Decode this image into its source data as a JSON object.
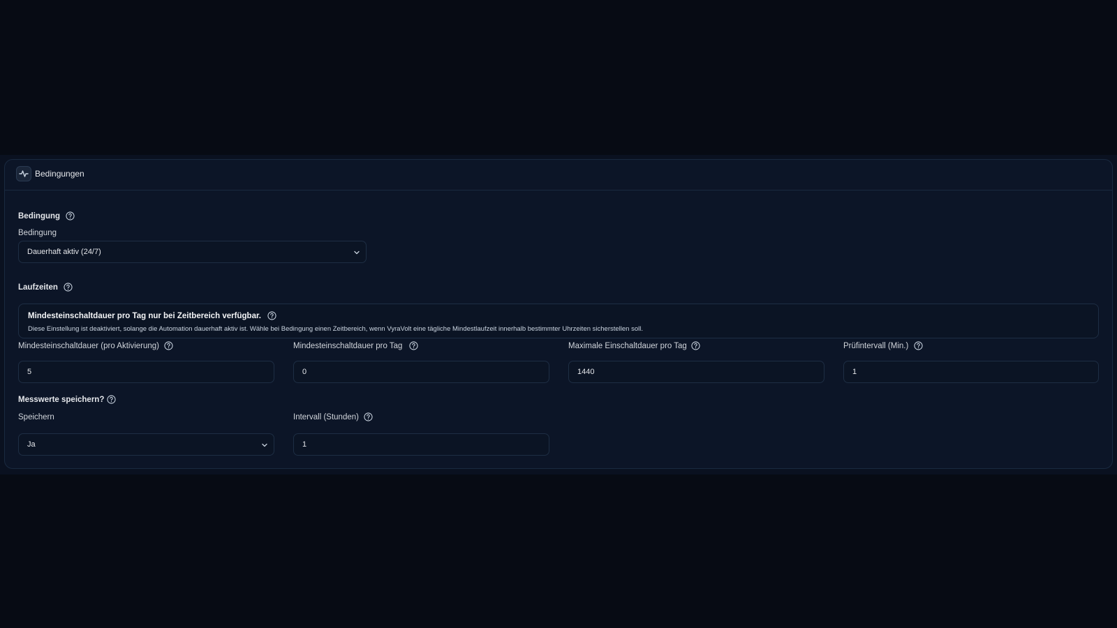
{
  "card": {
    "title": "Bedingungen",
    "icon": "activity-icon"
  },
  "bedingung": {
    "section_label": "Bedingung",
    "field_label": "Bedingung",
    "selected": "Dauerhaft aktiv (24/7)"
  },
  "laufzeiten": {
    "section_label": "Laufzeiten",
    "notice_title": "Mindesteinschaltdauer pro Tag nur bei Zeitbereich verfügbar.",
    "notice_text": "Diese Einstellung ist deaktiviert, solange die Automation dauerhaft aktiv ist. Wähle bei Bedingung einen Zeitbereich, wenn VyraVolt eine tägliche Mindestlaufzeit innerhalb bestimmter Uhrzeiten sicherstellen soll.",
    "fields": [
      {
        "label": "Mindesteinschaltdauer (pro Aktivierung)",
        "value": "5"
      },
      {
        "label": "Mindesteinschaltdauer pro Tag",
        "value": "0"
      },
      {
        "label": "Maximale Einschaltdauer pro Tag",
        "value": "1440"
      },
      {
        "label": "Prüfintervall (Min.)",
        "value": "1"
      }
    ]
  },
  "messwerte": {
    "section_label": "Messwerte speichern?",
    "speichern": {
      "label": "Speichern",
      "selected": "Ja"
    },
    "intervall": {
      "label": "Intervall (Stunden)",
      "value": "1"
    }
  },
  "colors": {
    "background": "#070b14",
    "card": "#0c1527",
    "border": "#1a2a40",
    "text": "#e5e7eb"
  }
}
